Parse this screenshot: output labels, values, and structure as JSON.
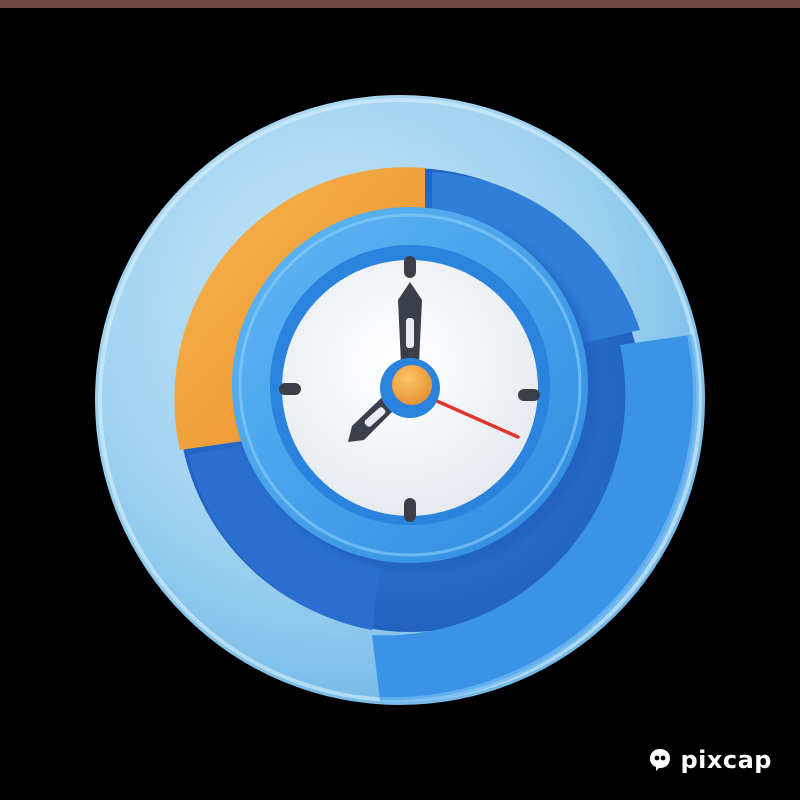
{
  "image": {
    "subject": "clock-with-ring-chart-icon",
    "colors": {
      "background": "#000000",
      "top_strip": "#6e4a45",
      "outer_ring_light": "#a9d8f2",
      "outer_ring_mid": "#7cc1ec",
      "segment_orange": "#f6a73b",
      "segment_dark_blue": "#2f7ed8",
      "segment_bright_blue": "#3d9be9",
      "clock_rim": "#45a6ee",
      "clock_face": "#f4f6f8",
      "hands": "#3a3f4a",
      "second_hand": "#e0342c",
      "center_cap": "#f4a23a"
    },
    "clock": {
      "hour_hand_points_to": 8,
      "minute_hand_points_to": 12,
      "second_hand_direction": "toward-4"
    }
  },
  "watermark": {
    "icon": "pixcap-logo-icon",
    "text": "pixcap"
  }
}
